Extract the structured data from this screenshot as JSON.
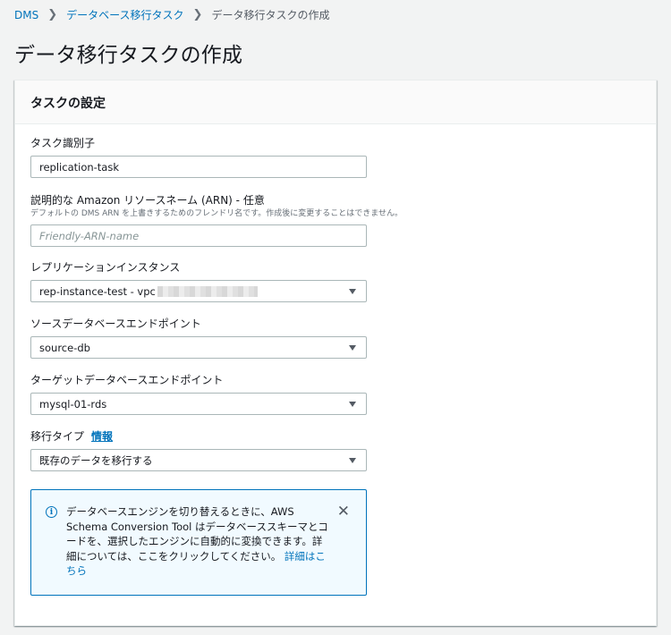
{
  "breadcrumb": {
    "root": "DMS",
    "parent": "データベース移行タスク",
    "current": "データ移行タスクの作成"
  },
  "page_title": "データ移行タスクの作成",
  "panel": {
    "title": "タスクの設定",
    "task_identifier": {
      "label": "タスク識別子",
      "value": "replication-task"
    },
    "arn": {
      "label": "説明的な Amazon リソースネーム (ARN) - 任意",
      "description": "デフォルトの DMS ARN を上書きするためのフレンドリ名です。作成後に変更することはできません。",
      "placeholder": "Friendly-ARN-name",
      "value": ""
    },
    "replication_instance": {
      "label": "レプリケーションインスタンス",
      "value": "rep-instance-test - vpc"
    },
    "source_endpoint": {
      "label": "ソースデータベースエンドポイント",
      "value": "source-db"
    },
    "target_endpoint": {
      "label": "ターゲットデータベースエンドポイント",
      "value": "mysql-01-rds"
    },
    "migration_type": {
      "label": "移行タイプ",
      "info_link": "情報",
      "value": "既存のデータを移行する"
    },
    "alert": {
      "text": "データベースエンジンを切り替えるときに、AWS Schema Conversion Tool はデータベーススキーマとコードを、選択したエンジンに自動的に変換できます。詳細については、ここをクリックしてください。",
      "link": "詳細はこちら",
      "icon": "info-icon",
      "close_icon": "close-icon"
    }
  },
  "colors": {
    "link": "#0073bb",
    "alert_bg": "#f1faff",
    "page_bg": "#f2f3f3"
  }
}
